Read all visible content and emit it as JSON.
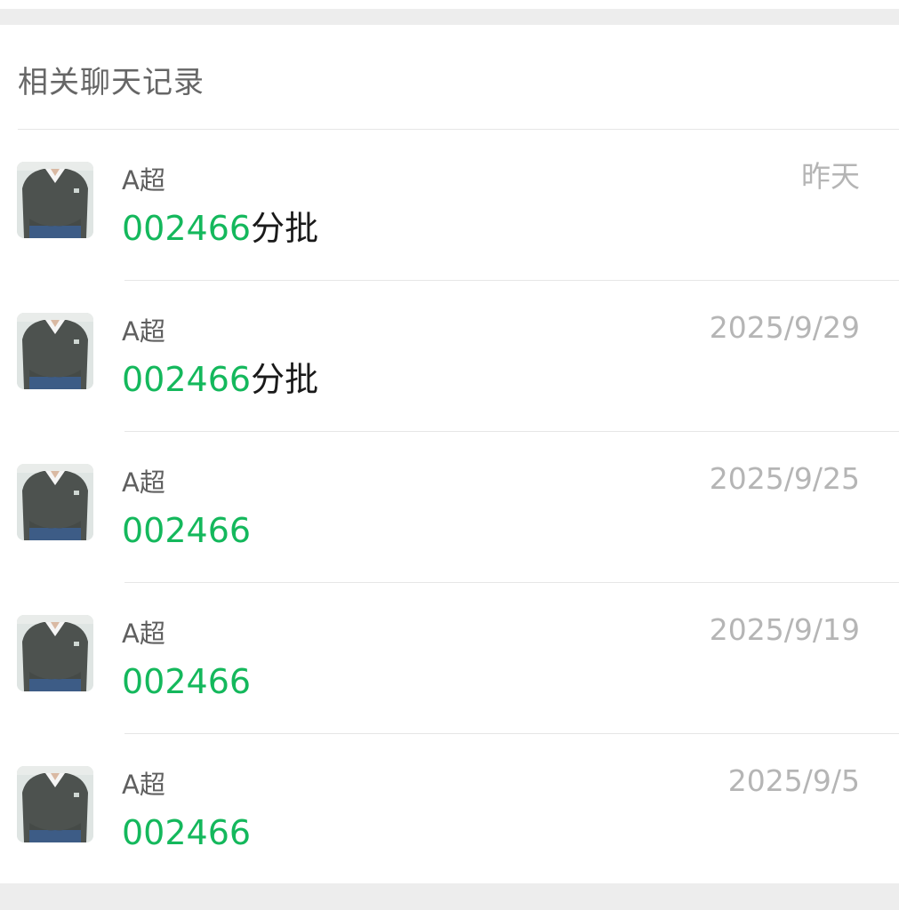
{
  "section": {
    "title": "相关聊天记录"
  },
  "results": [
    {
      "sender": "A超",
      "date": "昨天",
      "highlight": "002466",
      "rest": "分批"
    },
    {
      "sender": "A超",
      "date": "2025/9/29",
      "highlight": "002466",
      "rest": "分批"
    },
    {
      "sender": "A超",
      "date": "2025/9/25",
      "highlight": "002466",
      "rest": ""
    },
    {
      "sender": "A超",
      "date": "2025/9/19",
      "highlight": "002466",
      "rest": ""
    },
    {
      "sender": "A超",
      "date": "2025/9/5",
      "highlight": "002466",
      "rest": ""
    }
  ],
  "colors": {
    "highlight": "#14b85c",
    "text_primary": "#1a1a1a",
    "text_secondary": "#5f5f5f",
    "text_muted": "#b5b5b5",
    "page_bg": "#ededed"
  }
}
